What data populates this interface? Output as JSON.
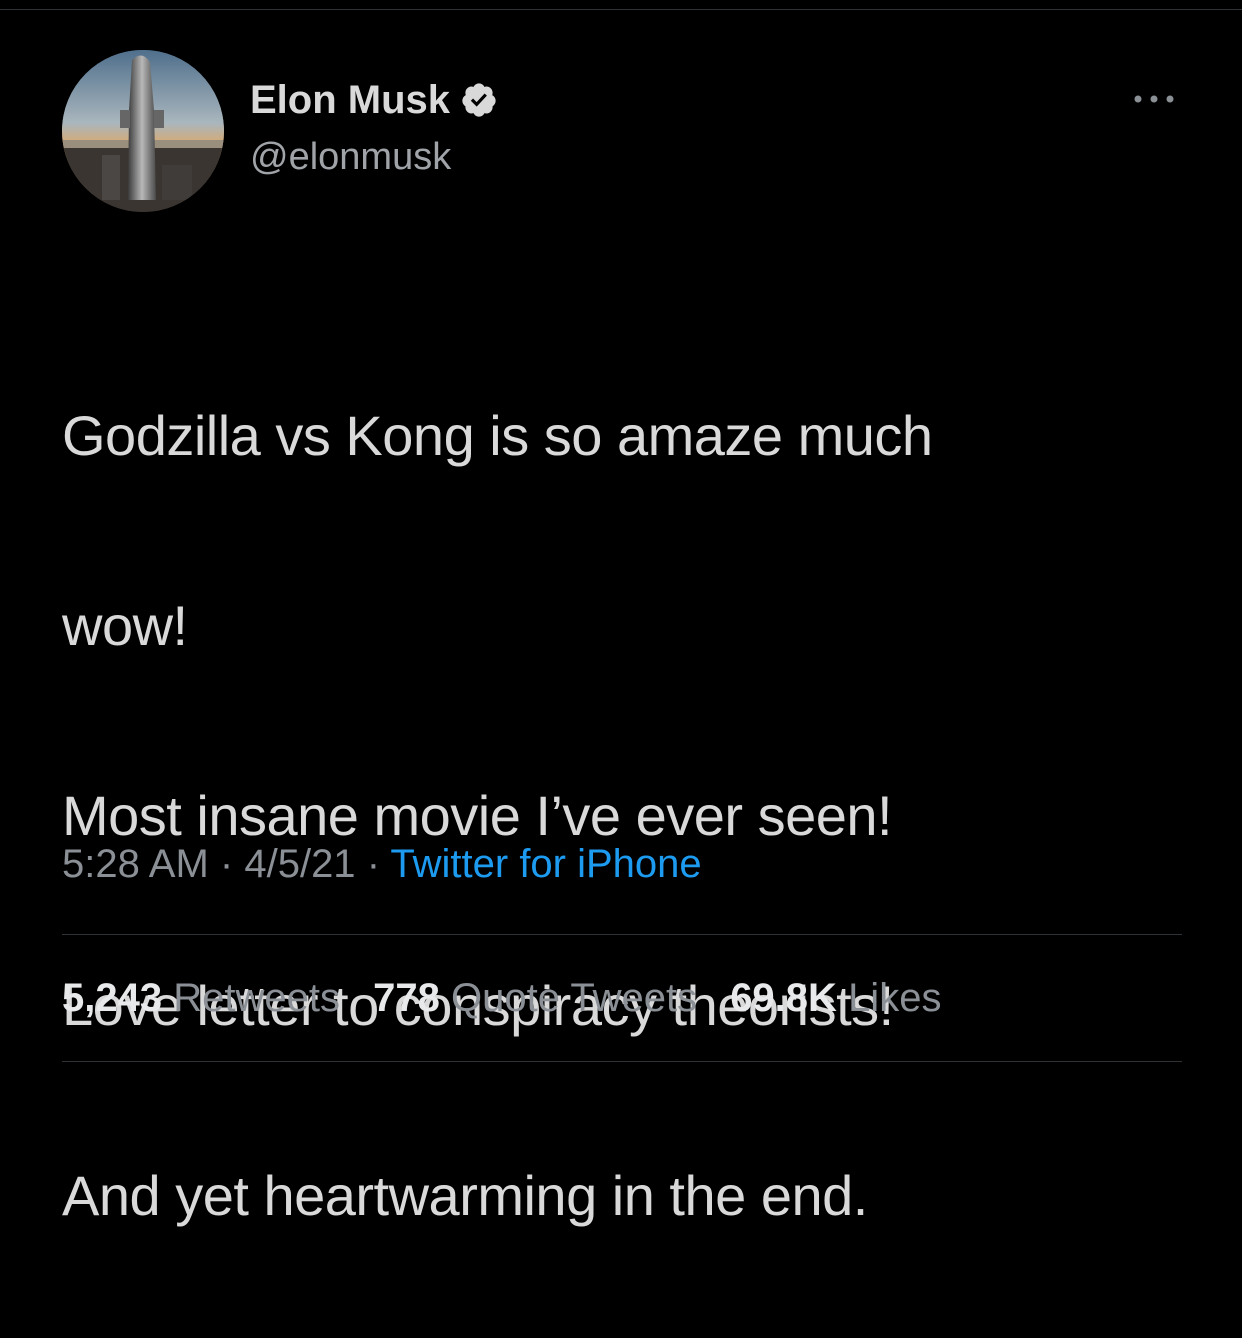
{
  "author": {
    "display_name": "Elon Musk",
    "handle": "@elonmusk",
    "verified_icon": "verified-badge-icon",
    "avatar_icon": "avatar-starship-photo"
  },
  "tweet": {
    "lines": [
      "Godzilla vs Kong is so amaze much",
      "wow!",
      "Most insane movie I’ve ever seen!",
      "Love letter to conspiracy theorists!",
      "And yet heartwarming in the end."
    ],
    "time": "5:28 AM",
    "separator": "·",
    "date": "4/5/21",
    "source": "Twitter for iPhone"
  },
  "stats": {
    "retweets_count": "5,243",
    "retweets_label": "Retweets",
    "quotes_count": "778",
    "quotes_label": "Quote Tweets",
    "likes_count": "69.8K",
    "likes_label": "Likes"
  },
  "colors": {
    "background": "#000000",
    "primary_text": "#d9d9d9",
    "secondary_text": "#8b9096",
    "link": "#1d9bf0",
    "divider": "#2f3336"
  },
  "icons": {
    "more": "more-options-icon"
  }
}
